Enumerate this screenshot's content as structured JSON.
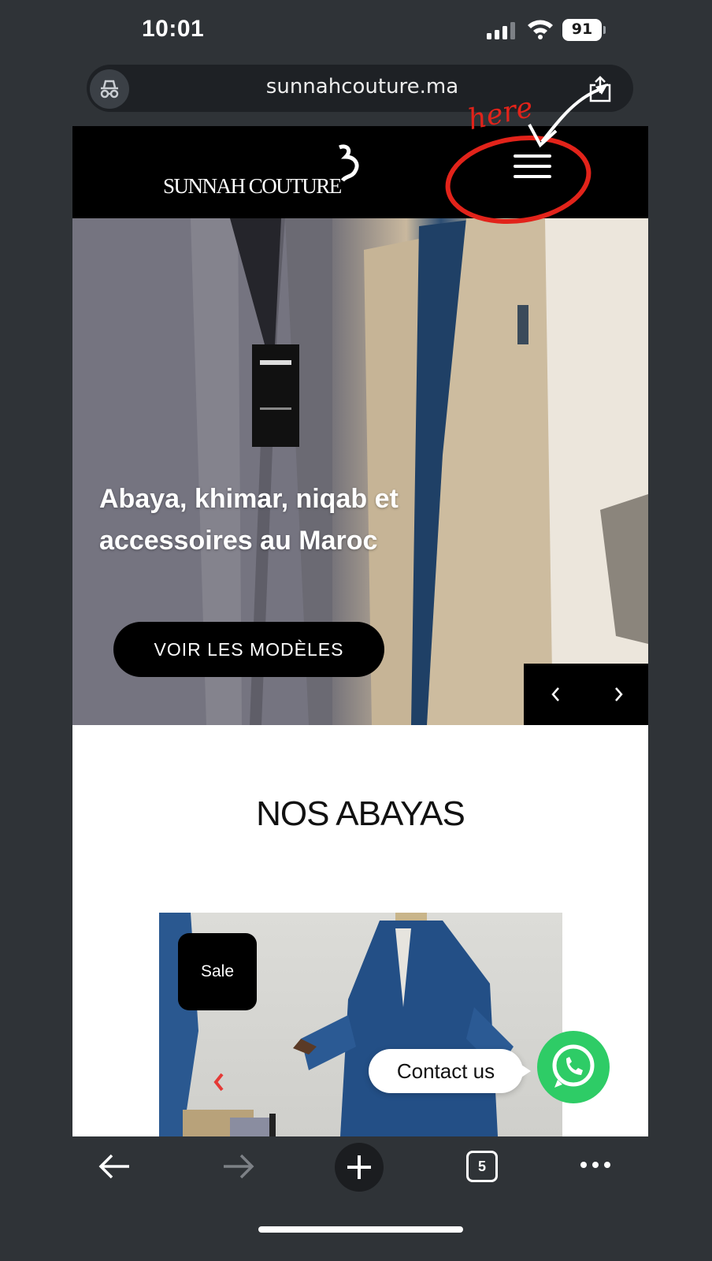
{
  "status_bar": {
    "time": "10:01",
    "battery": "91"
  },
  "browser": {
    "url": "sunnahcouture.ma",
    "tab_count": "5"
  },
  "site": {
    "logo_text": "SUNNAH COUTURE",
    "hero": {
      "title": "Abaya, khimar, niqab et accessoires au Maroc",
      "button_label": "VOIR LES MODÈLES"
    },
    "section_title": "NOS ABAYAS",
    "product": {
      "badge": "Sale"
    },
    "contact_label": "Contact us"
  },
  "annotation": {
    "text": "here",
    "color": "#e2231a"
  },
  "colors": {
    "whatsapp": "#2ecc66",
    "header_bg": "#000000",
    "browser_bg": "#2f3337"
  }
}
